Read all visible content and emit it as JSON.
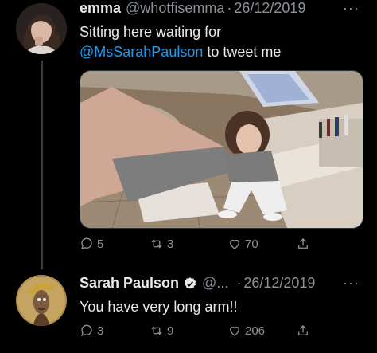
{
  "tweets": [
    {
      "display_name": "emma",
      "handle": "@whotfisemma",
      "separator": "·",
      "date": "26/12/2019",
      "more": "···",
      "text_line1": "Sitting here waiting for",
      "mention": "@MsSarahPaulson",
      "text_after_mention": " to tweet me",
      "replies": "5",
      "retweets": "3",
      "likes": "70",
      "has_media": true,
      "avatar_icon": "profile-photo"
    },
    {
      "display_name": "Sarah Paulson",
      "handle": "@...",
      "separator": "·",
      "date": "26/12/2019",
      "more": "···",
      "text": "You have very long arm!!",
      "replies": "3",
      "retweets": "9",
      "likes": "206",
      "verified": true,
      "avatar_icon": "illustrated-portrait"
    }
  ],
  "colors": {
    "background": "#000000",
    "text": "#e7e9ea",
    "muted": "#8b9197",
    "mention": "#1d9bf0"
  }
}
